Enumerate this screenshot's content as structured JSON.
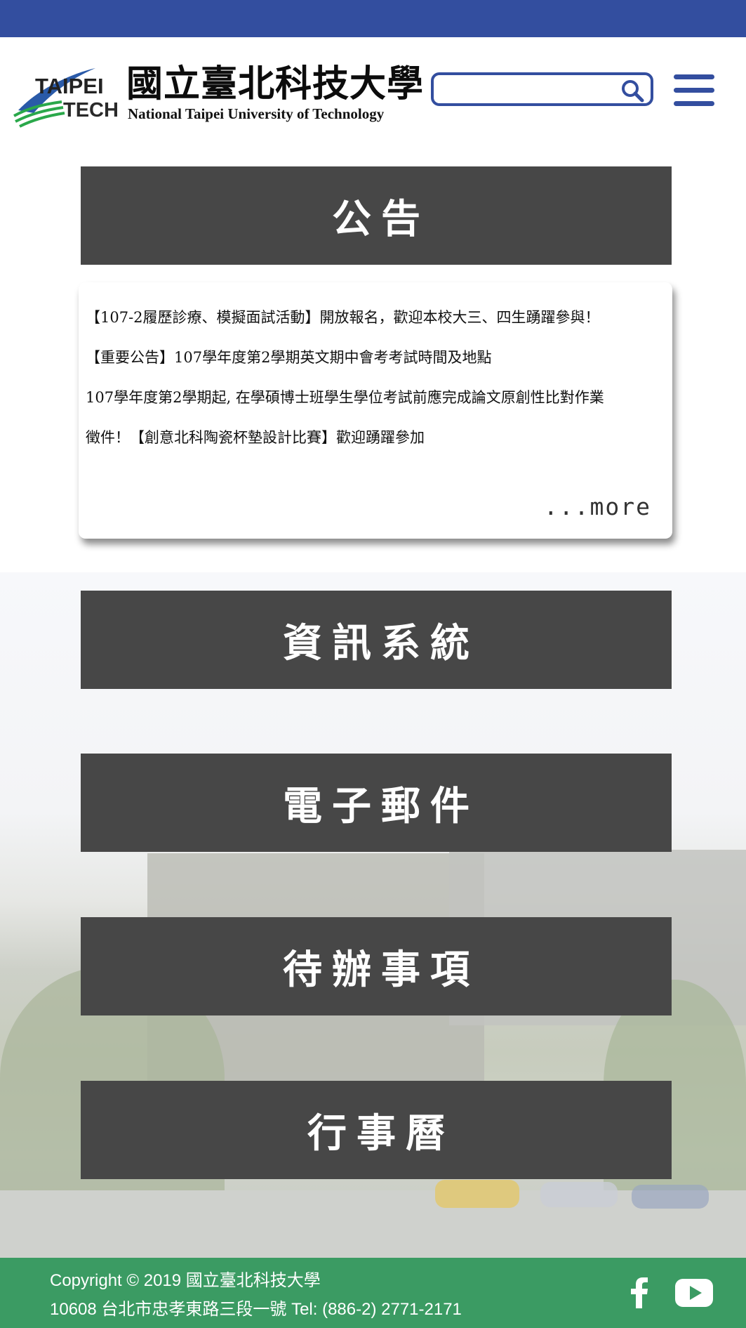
{
  "header": {
    "logo_en_line1": "TAIPEI",
    "logo_en_line2": "TECH",
    "logo_zh": "國立臺北科技大學",
    "logo_full_en": "National Taipei University of Technology",
    "search_value": ""
  },
  "announcements": {
    "title": "公告",
    "items": [
      "【107-2履歷診療、模擬面試活動】開放報名，歡迎本校大三、四生踴躍參與！",
      "【重要公告】107學年度第2學期英文期中會考考試時間及地點",
      "107學年度第2學期起, 在學碩博士班學生學位考試前應完成論文原創性比對作業",
      "徵件！【創意北科陶瓷杯墊設計比賽】歡迎踴躍參加"
    ],
    "more_label": "...more"
  },
  "sections": [
    {
      "label": "資訊系統"
    },
    {
      "label": "電子郵件"
    },
    {
      "label": "待辦事項"
    },
    {
      "label": "行事曆"
    }
  ],
  "footer": {
    "copyright": "Copyright © 2019 國立臺北科技大學",
    "address": "10608 台北市忠孝東路三段一號 Tel: (886-2) 2771-2171"
  },
  "colors": {
    "topbar": "#334e9f",
    "banner": "#474747",
    "footer": "#3b9b63"
  },
  "icons": [
    "search-icon",
    "menu-icon",
    "facebook-icon",
    "youtube-icon"
  ]
}
